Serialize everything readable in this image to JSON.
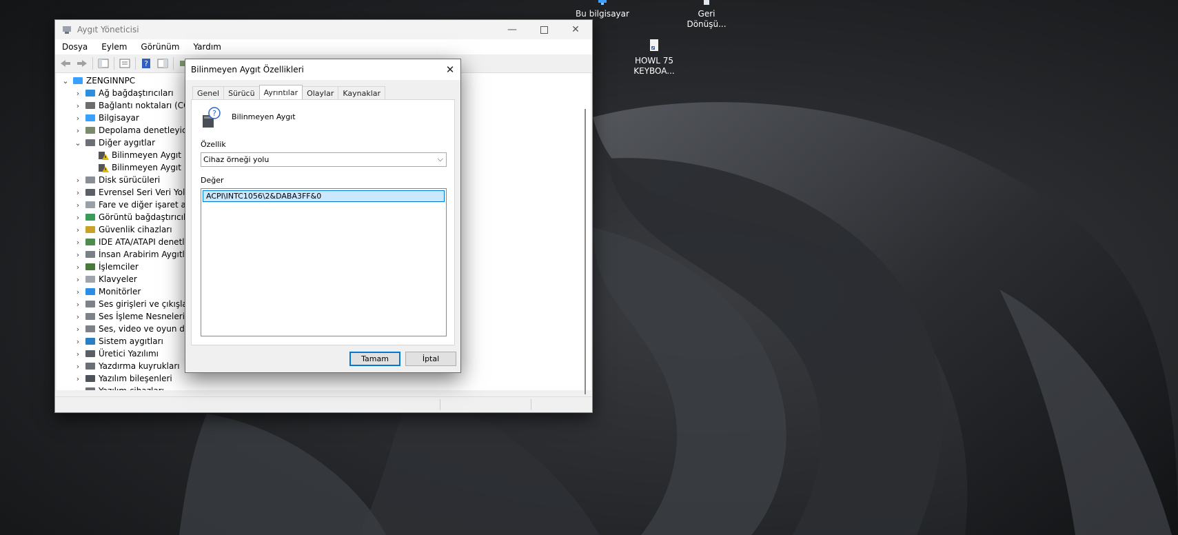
{
  "desktop": {
    "icons": [
      {
        "label": "Bu bilgisayar",
        "icon": "computer-icon"
      },
      {
        "label": "Geri Dönüşü...",
        "icon": "recycle-bin-icon"
      },
      {
        "label": "HOWL 75 KEYBOA...",
        "icon": "shortcut-file-icon"
      }
    ]
  },
  "device_manager": {
    "title": "Aygıt Yöneticisi",
    "menu": [
      "Dosya",
      "Eylem",
      "Görünüm",
      "Yardım"
    ],
    "tree": {
      "root": "ZENGINNPC",
      "items": [
        {
          "label": "Ağ bağdaştırıcıları",
          "icon": "network-adapter-icon",
          "expanded": false
        },
        {
          "label": "Bağlantı noktaları (COM",
          "icon": "port-icon",
          "expanded": false
        },
        {
          "label": "Bilgisayar",
          "icon": "computer-icon",
          "expanded": false
        },
        {
          "label": "Depolama denetleyiciler",
          "icon": "storage-controller-icon",
          "expanded": false
        },
        {
          "label": "Diğer aygıtlar",
          "icon": "other-devices-icon",
          "expanded": true
        },
        {
          "label": "Bilinmeyen Aygıt",
          "icon": "unknown-device-warning-icon",
          "child": true
        },
        {
          "label": "Bilinmeyen Aygıt",
          "icon": "unknown-device-warning-icon",
          "child": true
        },
        {
          "label": "Disk sürücüleri",
          "icon": "disk-drive-icon",
          "expanded": false
        },
        {
          "label": "Evrensel Seri Veri Yolu de",
          "icon": "usb-controller-icon",
          "expanded": false
        },
        {
          "label": "Fare ve diğer işaret aygıt",
          "icon": "mouse-icon",
          "expanded": false
        },
        {
          "label": "Görüntü bağdaştırıcıları",
          "icon": "display-adapter-icon",
          "expanded": false
        },
        {
          "label": "Güvenlik cihazları",
          "icon": "security-device-icon",
          "expanded": false
        },
        {
          "label": "IDE ATA/ATAPI denetley",
          "icon": "ide-controller-icon",
          "expanded": false
        },
        {
          "label": "İnsan Arabirim Aygıtları",
          "icon": "hid-icon",
          "expanded": false
        },
        {
          "label": "İşlemciler",
          "icon": "processor-icon",
          "expanded": false
        },
        {
          "label": "Klavyeler",
          "icon": "keyboard-icon",
          "expanded": false
        },
        {
          "label": "Monitörler",
          "icon": "monitor-icon",
          "expanded": false
        },
        {
          "label": "Ses girişleri ve çıkışları",
          "icon": "speaker-icon",
          "expanded": false
        },
        {
          "label": "Ses İşleme Nesneleri (AP",
          "icon": "speaker-icon",
          "expanded": false
        },
        {
          "label": "Ses, video ve oyun dene",
          "icon": "speaker-icon",
          "expanded": false
        },
        {
          "label": "Sistem aygıtları",
          "icon": "system-device-icon",
          "expanded": false
        },
        {
          "label": "Üretici Yazılımı",
          "icon": "firmware-icon",
          "expanded": false
        },
        {
          "label": "Yazdırma kuyrukları",
          "icon": "printer-icon",
          "expanded": false
        },
        {
          "label": "Yazılım bileşenleri",
          "icon": "software-component-icon",
          "expanded": false
        },
        {
          "label": "Yazılım cihazları",
          "icon": "software-device-icon",
          "expanded": false
        }
      ]
    }
  },
  "properties_dialog": {
    "title": "Bilinmeyen Aygıt Özellikleri",
    "tabs": [
      "Genel",
      "Sürücü",
      "Ayrıntılar",
      "Olaylar",
      "Kaynaklar"
    ],
    "active_tab": "Ayrıntılar",
    "device_name": "Bilinmeyen Aygıt",
    "property_label": "Özellik",
    "property_value": "Cihaz örneği yolu",
    "value_label": "Değer",
    "value": "ACPI\\INTC1056\\2&DABA3FF&0",
    "ok_label": "Tamam",
    "cancel_label": "İptal"
  },
  "colors": {
    "accent": "#0078d7",
    "selection": "#cce8ff"
  }
}
